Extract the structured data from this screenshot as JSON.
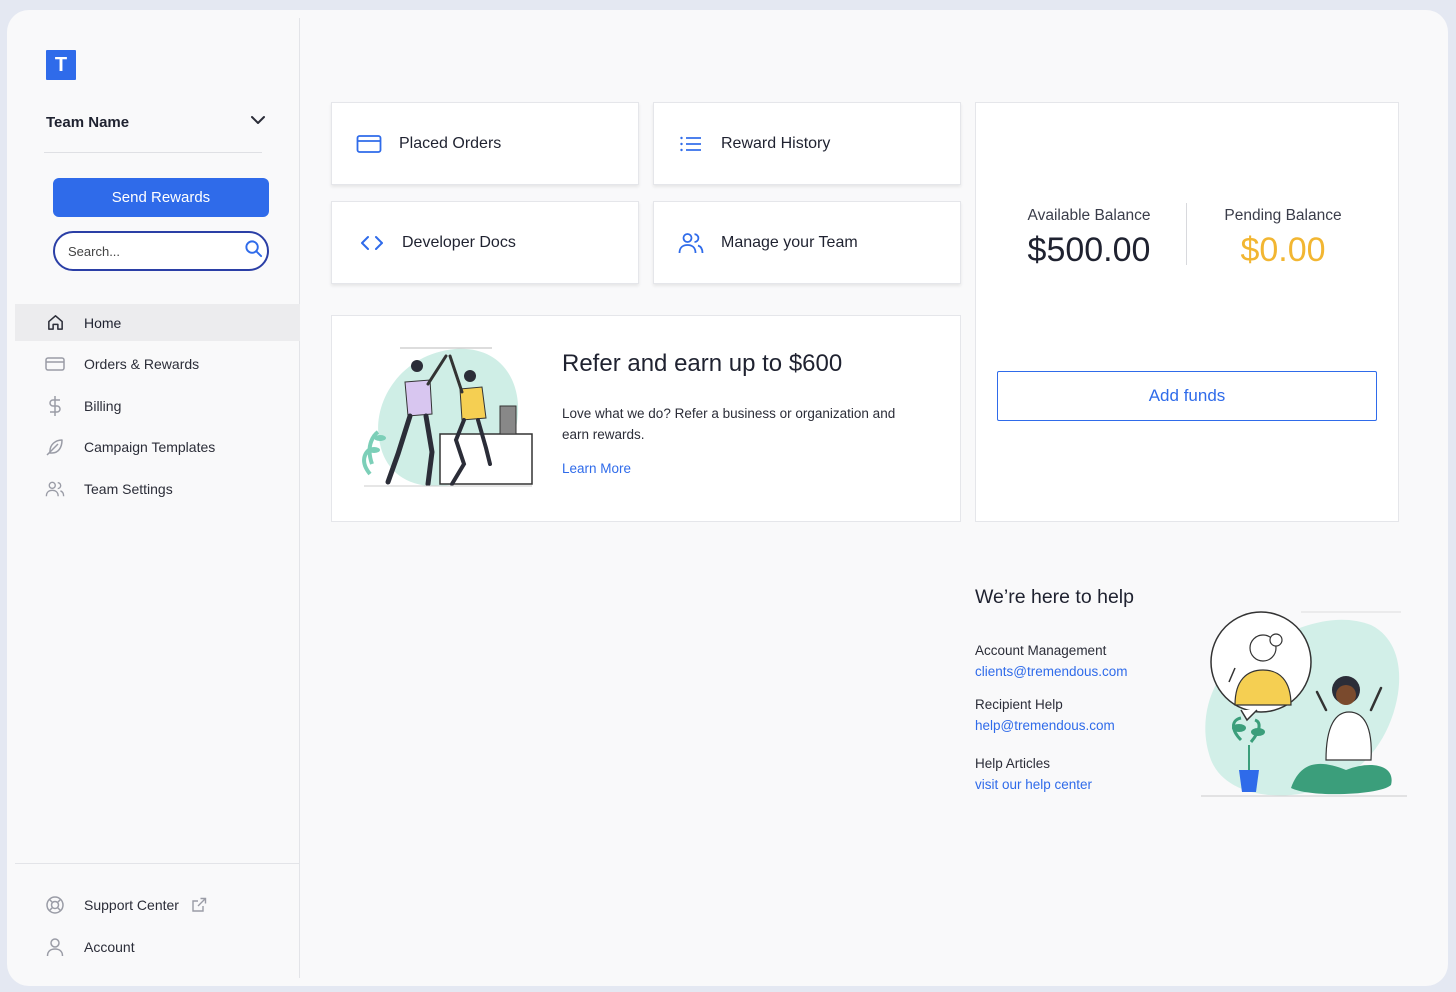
{
  "sidebar": {
    "logo_letter": "T",
    "team_name": "Team Name",
    "send_rewards_label": "Send Rewards",
    "search_placeholder": "Search...",
    "items": [
      {
        "label": "Home",
        "icon": "home-icon",
        "active": true
      },
      {
        "label": "Orders & Rewards",
        "icon": "card-icon"
      },
      {
        "label": "Billing",
        "icon": "dollar-icon"
      },
      {
        "label": "Campaign Templates",
        "icon": "feather-icon"
      },
      {
        "label": "Team Settings",
        "icon": "users-icon"
      }
    ],
    "bottom_items": [
      {
        "label": "Support Center",
        "icon": "lifebuoy-icon"
      },
      {
        "label": "Account",
        "icon": "user-icon"
      }
    ]
  },
  "quick_links": [
    {
      "label": "Placed Orders",
      "icon": "card-icon"
    },
    {
      "label": "Reward History",
      "icon": "list-icon"
    },
    {
      "label": "Developer Docs",
      "icon": "code-icon"
    },
    {
      "label": "Manage your Team",
      "icon": "users-icon"
    }
  ],
  "refer": {
    "title": "Refer and earn up to $600",
    "body": "Love what we do? Refer a business or organization and earn rewards.",
    "link": "Learn More"
  },
  "balance": {
    "available_label": "Available Balance",
    "available_value": "$500.00",
    "pending_label": "Pending Balance",
    "pending_value": "$0.00",
    "add_funds_label": "Add funds"
  },
  "help": {
    "title": "We’re here to help",
    "account_label": "Account Management",
    "account_email": "clients@tremendous.com",
    "recipient_label": "Recipient Help",
    "recipient_email": "help@tremendous.com",
    "articles_label": "Help Articles",
    "articles_link": "visit our help center"
  },
  "colors": {
    "accent": "#2f6bea",
    "pending": "#f2b632",
    "text": "#1f2230"
  }
}
